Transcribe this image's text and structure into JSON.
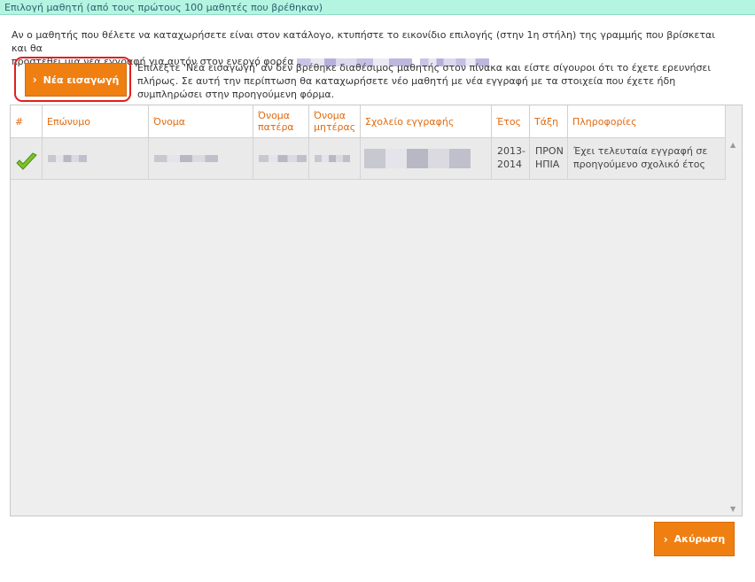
{
  "dialog": {
    "title": "Επιλογή μαθητή (από τους πρώτους 100 μαθητές που βρέθηκαν)",
    "intro_line1": "Αν ο μαθητής που θέλετε να καταχωρήσετε είναι στον κατάλογο, κτυπήστε το εικονίδιο επιλογής (στην 1η στήλη) της γραμμής που βρίσκεται και θα",
    "intro_line2": "προστέθει μια νέα εγγραφή για αυτόν στον ενεργό φορέα",
    "new_button_label": "Νέα εισαγωγή",
    "help_text": "Επιλέξτε 'Νέα εισαγωγή' αν δεν βρέθηκε διαθέσιμος μαθητής στον πίνακα και είστε σίγουροι ότι το έχετε ερευνήσει πλήρως. Σε αυτή την περίπτωση θα καταχωρήσετε νέο μαθητή με νέα εγγραφή με τα στοιχεία που έχετε ήδη συμπληρώσει στην προηγούμενη φόρμα.",
    "cancel_button_label": "Ακύρωση"
  },
  "table": {
    "columns": [
      "#",
      "Επώνυμο",
      "Όνομα",
      "Όνομα πατέρα",
      "Όνομα μητέρας",
      "Σχολείο εγγραφής",
      "Έτος",
      "Τάξη",
      "Πληροφορίες"
    ],
    "rows": [
      {
        "year": "2013-2014",
        "class": "ΠΡΟΝΗΠΙΑ",
        "info": "Έχει τελευταία εγγραφή σε προηγούμενο σχολικό έτος"
      }
    ]
  },
  "icons": {
    "select": "checkmark-icon",
    "scroll_up": "scroll-up-arrow-icon",
    "scroll_down": "scroll-down-arrow-icon",
    "chevron": "chevron-right-icon"
  },
  "colors": {
    "titlebar": "#b3f5e1",
    "accent": "#f07f12",
    "header_text": "#e06a10",
    "highlight": "#e0201c"
  }
}
